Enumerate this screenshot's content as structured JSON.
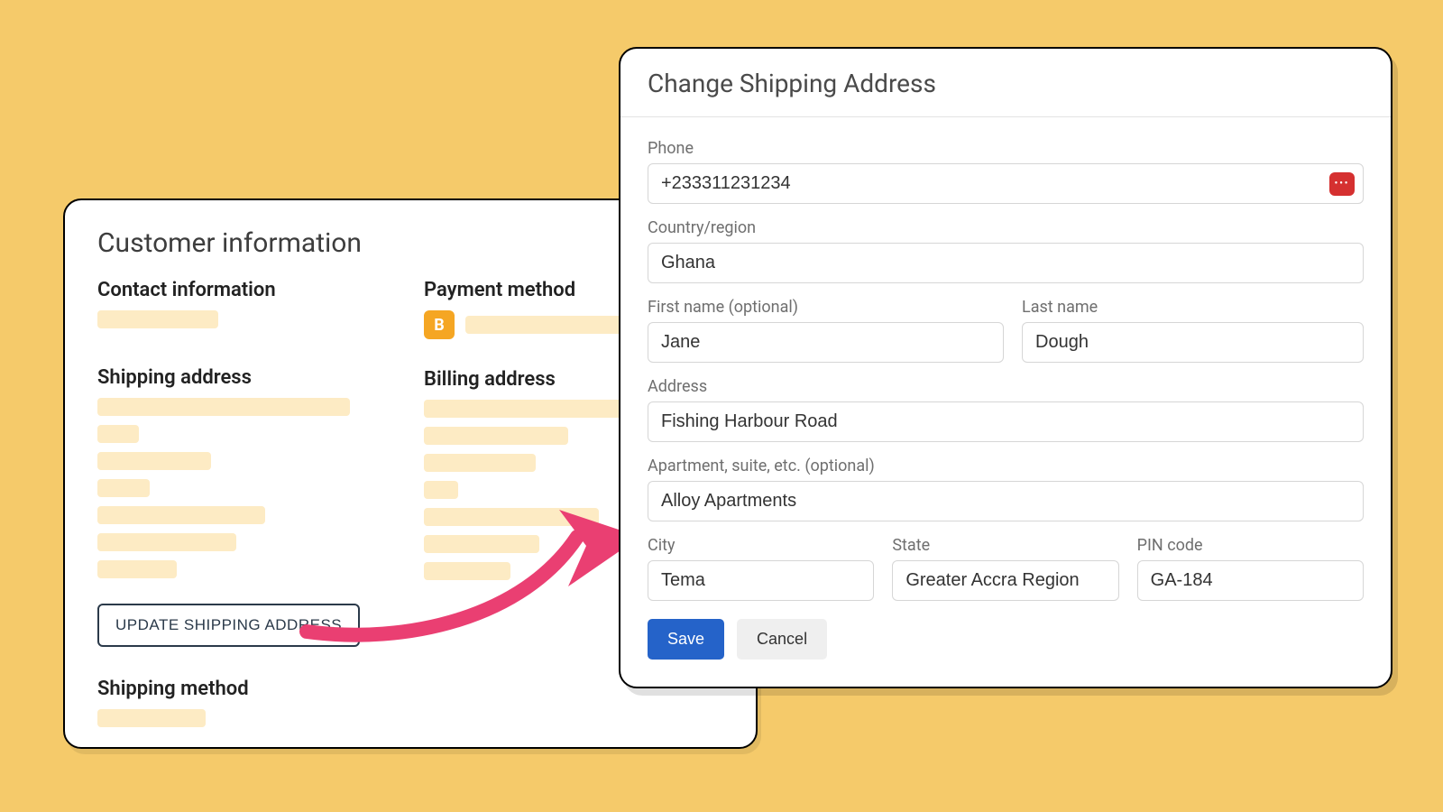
{
  "back_card": {
    "title": "Customer information",
    "contact_heading": "Contact information",
    "payment_heading": "Payment method",
    "payment_badge_letter": "B",
    "shipping_heading": "Shipping address",
    "billing_heading": "Billing address",
    "update_button_label": "UPDATE SHIPPING ADDRESS",
    "shipping_method_heading": "Shipping method"
  },
  "modal": {
    "title": "Change Shipping Address",
    "phone": {
      "label": "Phone",
      "value": "+233311231234"
    },
    "country": {
      "label": "Country/region",
      "value": "Ghana"
    },
    "first_name": {
      "label": "First name (optional)",
      "value": "Jane"
    },
    "last_name": {
      "label": "Last name",
      "value": "Dough"
    },
    "address": {
      "label": "Address",
      "value": "Fishing Harbour Road"
    },
    "apartment": {
      "label": "Apartment, suite, etc. (optional)",
      "value": "Alloy Apartments"
    },
    "city": {
      "label": "City",
      "value": "Tema"
    },
    "state": {
      "label": "State",
      "value": "Greater Accra Region"
    },
    "pin": {
      "label": "PIN code",
      "value": "GA-184"
    },
    "save_label": "Save",
    "cancel_label": "Cancel"
  }
}
